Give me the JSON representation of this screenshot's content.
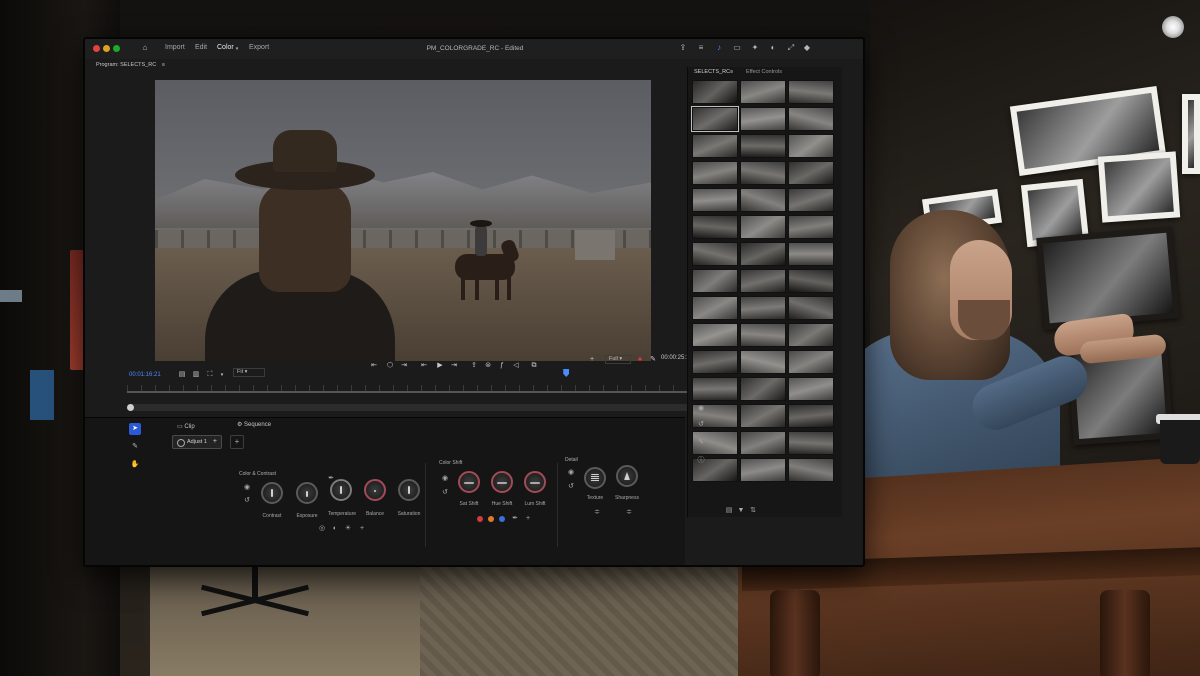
{
  "titlebar": {
    "nav": [
      "Import",
      "Edit",
      "Color",
      "Export"
    ],
    "active_nav": "Color",
    "document_title": "PM_COLORGRADE_RC - Edited"
  },
  "program_monitor": {
    "label": "Program: SELECTS_RC",
    "timecode_current": "00:01:16:21",
    "timecode_duration": "00:00:25:17",
    "zoom": "Fit",
    "quality": "Full",
    "playhead_fraction": 0.76
  },
  "media_panel": {
    "tabs": [
      "SELECTS_RC",
      "Effect Controls"
    ]
  },
  "color_panel": {
    "tabs": [
      "Clip",
      "Sequence"
    ],
    "adjustment_layer": "Adjust 1",
    "sections": {
      "color_contrast": {
        "title": "Color & Contrast",
        "controls": [
          "Contrast",
          "Exposure",
          "Temperature",
          "Balance",
          "Saturation"
        ]
      },
      "color_shift": {
        "title": "Color Shift",
        "controls": [
          "Sat Shift",
          "Hue Shift",
          "Lum Shift"
        ]
      },
      "detail": {
        "title": "Detail",
        "controls": [
          "Texture",
          "Sharpness"
        ]
      }
    }
  },
  "icons": {
    "home": "home-icon",
    "menu": "hamburger-icon",
    "share": "share-icon",
    "add": "plus-icon",
    "selection": "selection-arrow-icon",
    "hand": "hand-icon",
    "eye": "eye-icon",
    "reset": "reset-icon",
    "wrench": "wrench-icon"
  },
  "colors": {
    "accent": "#4a8cff",
    "shift_ring": "#a24a57"
  }
}
